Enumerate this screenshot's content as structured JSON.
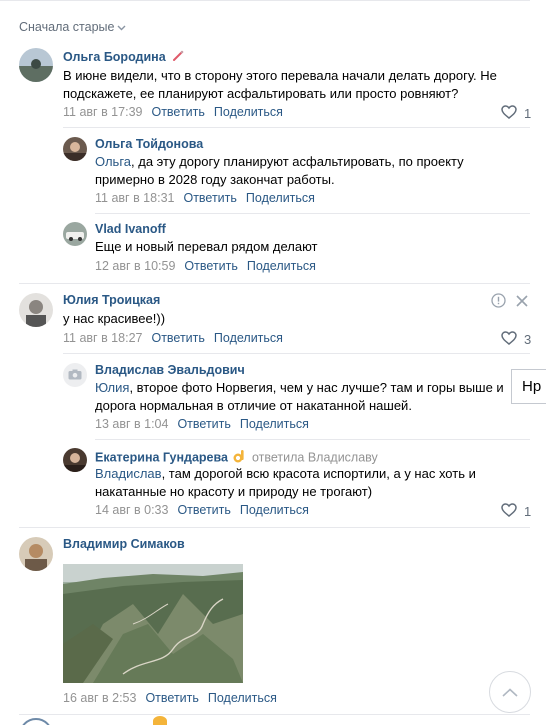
{
  "sort": {
    "label": "Сначала старые"
  },
  "comments": [
    {
      "author": "Ольга Бородина",
      "text": "В июне видели, что в сторону этого перевала начали делать дорогу. Не подскажете, ее планируют асфальтировать или просто ровняют?",
      "date": "11 авг в 17:39",
      "reply": "Ответить",
      "share": "Поделиться",
      "likes": "1"
    },
    {
      "author": "Ольга Тойдонова",
      "mention": "Ольга",
      "text": ", да эту дорогу планируют асфальтировать, по проекту примерно в 2028 году закончат работы.",
      "date": "11 авг в 18:31",
      "reply": "Ответить",
      "share": "Поделиться"
    },
    {
      "author": "Vlad Ivanoff",
      "text": "Еще и новый перевал рядом делают",
      "date": "12 авг в 10:59",
      "reply": "Ответить",
      "share": "Поделиться"
    },
    {
      "author": "Юлия Троицкая",
      "text": "у нас красивее!))",
      "date": "11 авг в 18:27",
      "reply": "Ответить",
      "share": "Поделиться",
      "likes": "3"
    },
    {
      "author": "Владислав Эвальдович",
      "mention": "Юлия",
      "text": ", второе фото Норвегия, чем у нас лучше? там и горы выше и дорога нормальная в отличие от накатанной нашей.",
      "date": "13 авг в 1:04",
      "reply": "Ответить",
      "share": "Поделиться"
    },
    {
      "author": "Екатерина Гундарева",
      "reply_to": "ответила Владиславу",
      "mention": "Владислав",
      "text": ", там дорогой всю красота испортили, а у нас хоть и накатанные но красоту и природу не трогают)",
      "date": "14 авг в 0:33",
      "reply": "Ответить",
      "share": "Поделиться",
      "likes": "1"
    },
    {
      "author": "Владимир Симаков",
      "date": "16 авг в 2:53",
      "reply": "Ответить",
      "share": "Поделиться"
    }
  ],
  "tooltip": {
    "text": "Нр"
  },
  "colors": {
    "link": "#2a5885",
    "meta": "#939393",
    "separator": "#e7e8ec"
  },
  "icons": [
    "chevron-down-icon",
    "heart-icon",
    "report-icon",
    "close-icon",
    "camera-icon",
    "ok-hand-emoji",
    "scroll-up-icon"
  ]
}
